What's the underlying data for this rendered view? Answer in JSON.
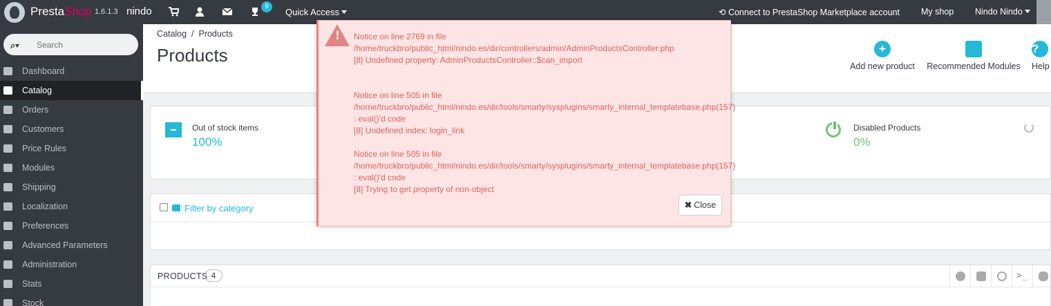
{
  "header": {
    "brand_presta": "Presta",
    "brand_shop": "Shop",
    "version": "1.6.1.3",
    "shop_name": "nindo",
    "notification_count": "9",
    "quick_access": "Quick Access",
    "connect": "Connect to PrestaShop Marketplace account",
    "my_shop": "My shop",
    "user": "Nindo Nindo"
  },
  "sidebar": {
    "search_placeholder": "Search",
    "items": [
      {
        "label": "Dashboard",
        "active": false
      },
      {
        "label": "Catalog",
        "active": true
      },
      {
        "label": "Orders",
        "active": false
      },
      {
        "label": "Customers",
        "active": false
      },
      {
        "label": "Price Rules",
        "active": false
      },
      {
        "label": "Modules",
        "active": false
      },
      {
        "label": "Shipping",
        "active": false
      },
      {
        "label": "Localization",
        "active": false
      },
      {
        "label": "Preferences",
        "active": false
      },
      {
        "label": "Advanced Parameters",
        "active": false
      },
      {
        "label": "Administration",
        "active": false
      },
      {
        "label": "Stats",
        "active": false
      },
      {
        "label": "Stock",
        "active": false
      }
    ]
  },
  "page": {
    "breadcrumb_catalog": "Catalog",
    "breadcrumb_sep": "/",
    "breadcrumb_products": "Products",
    "title": "Products",
    "toolbar": {
      "add_new": "Add new product",
      "recommended": "Recommended Modules",
      "help": "Help"
    }
  },
  "kpi": {
    "out_of_stock_label": "Out of stock items",
    "out_of_stock_value": "100%",
    "disabled_label": "Disabled Products",
    "disabled_value": "0%"
  },
  "filter": {
    "label": "Filter by category"
  },
  "products_panel": {
    "title": "PRODUCTS",
    "count": "4",
    "terminal_glyph": ">_"
  },
  "modal": {
    "notices": [
      {
        "lines": [
          "Notice on line 2769 in file",
          "/home/truckbro/public_html/nindo.es/dir/controllers/admin/AdminProductsController.php",
          "[8] Undefined property: AdminProductsController::$can_import"
        ]
      },
      {
        "lines": [
          "Notice on line 505 in file",
          "/home/truckbro/public_html/nindo.es/dir/tools/smarty/sysplugins/smarty_internal_templatebase.php(157)",
          ": eval()'d code",
          "[8] Undefined index: login_link"
        ]
      },
      {
        "lines": [
          "Notice on line 505 in file",
          "/home/truckbro/public_html/nindo.es/dir/tools/smarty/sysplugins/smarty_internal_templatebase.php(157)",
          ": eval()'d code",
          "[8] Trying to get property of non-object"
        ]
      }
    ],
    "close_label": "Close"
  },
  "colors": {
    "header_bg": "#363a41",
    "accent": "#25b9d7",
    "success": "#72c279",
    "notice_bg": "#fee5e5",
    "notice_text": "#d9625f"
  }
}
